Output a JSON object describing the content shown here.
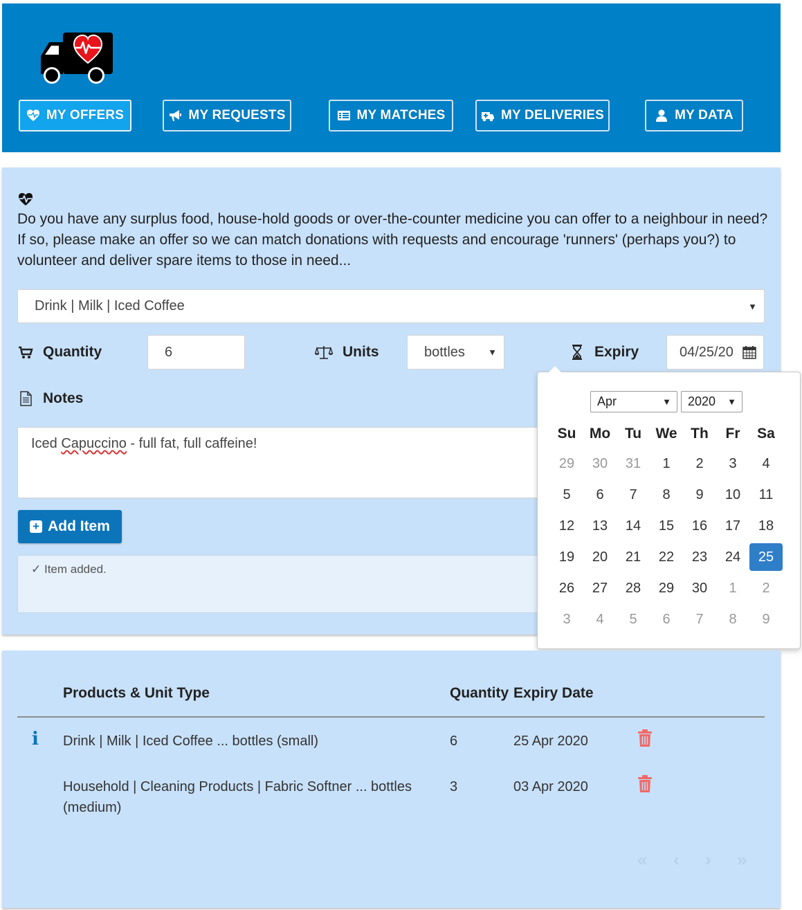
{
  "nav": {
    "offers": "MY OFFERS",
    "requests": "MY REQUESTS",
    "matches": "MY MATCHES",
    "deliveries": "MY DELIVERIES",
    "data": "MY DATA"
  },
  "intro": {
    "text": "Do you have any surplus food, house-hold goods or over-the-counter medicine you can offer to a neighbour in need? If so, please make an offer so we can match donations with requests and encourage 'runners' (perhaps you?) to volunteer and deliver spare items to those in need..."
  },
  "form": {
    "product_value": "Drink | Milk | Iced Coffee",
    "quantity_label": "Quantity",
    "quantity_value": "6",
    "units_label": "Units",
    "units_value": "bottles",
    "expiry_label": "Expiry",
    "expiry_value": "04/25/20",
    "notes_label": "Notes",
    "notes_prefix": "Iced ",
    "notes_misspelled": "Capuccino",
    "notes_suffix": " - full fat, full caffeine!",
    "add_button": "Add Item",
    "status": "✓ Item added."
  },
  "datepicker": {
    "month": "Apr",
    "year": "2020",
    "weekdays": [
      "Su",
      "Mo",
      "Tu",
      "We",
      "Th",
      "Fr",
      "Sa"
    ],
    "weeks": [
      [
        "29",
        "30",
        "31",
        "1",
        "2",
        "3",
        "4"
      ],
      [
        "5",
        "6",
        "7",
        "8",
        "9",
        "10",
        "11"
      ],
      [
        "12",
        "13",
        "14",
        "15",
        "16",
        "17",
        "18"
      ],
      [
        "19",
        "20",
        "21",
        "22",
        "23",
        "24",
        "25"
      ],
      [
        "26",
        "27",
        "28",
        "29",
        "30",
        "1",
        "2"
      ],
      [
        "3",
        "4",
        "5",
        "6",
        "7",
        "8",
        "9"
      ]
    ],
    "selected_day": "25"
  },
  "table": {
    "headers": {
      "product": "Products & Unit Type",
      "quantity": "Quantity",
      "expiry": "Expiry Date"
    },
    "rows": [
      {
        "product": "Drink | Milk | Iced Coffee ... bottles (small)",
        "quantity": "6",
        "expiry": "25 Apr 2020"
      },
      {
        "product": "Household | Cleaning Products | Fabric Softner ... bottles (medium)",
        "quantity": "3",
        "expiry": "03 Apr 2020"
      }
    ]
  },
  "colors": {
    "header_bg": "#0080c6",
    "panel_bg": "#c8e1fa",
    "accent": "#0c75ba",
    "selected_day": "#2f7ec8",
    "trash": "#f06a6a"
  }
}
